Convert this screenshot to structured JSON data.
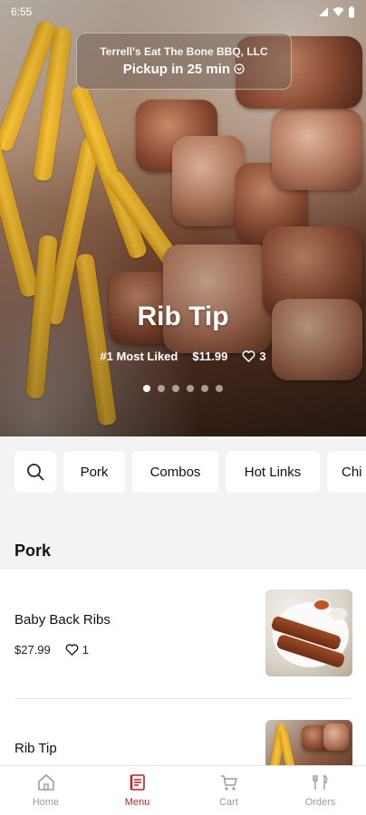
{
  "status_bar": {
    "time": "6:55"
  },
  "hero": {
    "restaurant": "Terrell's Eat The Bone BBQ, LLC",
    "pickup": "Pickup in 25 min",
    "title": "Rib Tip",
    "badge": "#1 Most Liked",
    "price": "$11.99",
    "likes": "3",
    "carousel": {
      "count": 6,
      "active_index": 0
    }
  },
  "categories": [
    "Pork",
    "Combos",
    "Hot Links",
    "Chi"
  ],
  "section": {
    "title": "Pork"
  },
  "items": [
    {
      "name": "Baby Back Ribs",
      "price": "$27.99",
      "likes": "1"
    },
    {
      "name": "Rib Tip"
    }
  ],
  "nav": [
    {
      "label": "Home",
      "icon": "home-icon"
    },
    {
      "label": "Menu",
      "icon": "menu-book-icon",
      "active": true
    },
    {
      "label": "Cart",
      "icon": "cart-icon"
    },
    {
      "label": "Orders",
      "icon": "orders-icon"
    }
  ],
  "colors": {
    "accent": "#c41e25",
    "inactive": "#9a9a9a",
    "background": "#f3f3f3"
  }
}
